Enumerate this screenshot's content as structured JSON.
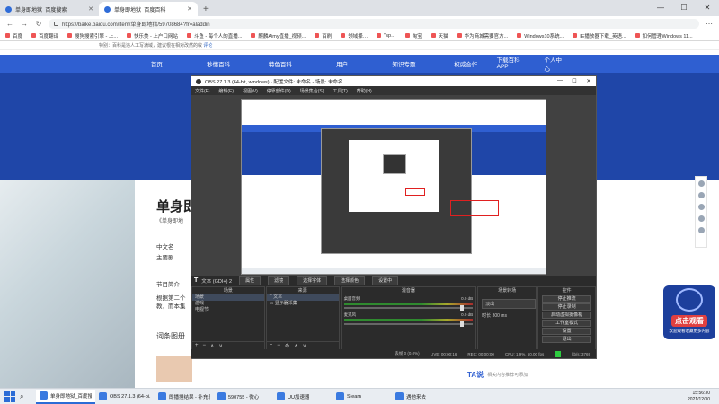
{
  "browser": {
    "tabs": [
      {
        "label": "单身即地狱_百度搜索",
        "active": false
      },
      {
        "label": "单身即地狱_百度百科",
        "active": true
      }
    ],
    "url": "https://baike.baidu.com/item/单身即地狱/59708684?fr=aladdin",
    "bookmarks": [
      "百度",
      "百度翻译",
      "搜狗搜索引擎 - 上...",
      "快乐美 - 上户口网站",
      "斗鱼 - 每个人的直播...",
      "麒麟Aimy直播_视频...",
      "百刷",
      "领域择…",
      "\"sp…",
      "淘宝",
      "天猫",
      "华为商城需要官方...",
      "Windows10系统...",
      "IE播放器下载_英语...",
      "如何管理Windows 11..."
    ]
  },
  "page": {
    "notice": "特别：百科是违人工写满域，建议根在相对改然的收",
    "notice_link": "评论",
    "nav": [
      "首页",
      "秒懂百科",
      "特色百科",
      "用户",
      "知识专题",
      "权威合作"
    ],
    "nav_right": [
      "下载百科APP",
      "个人中心"
    ],
    "title": "单身即",
    "subtitle": "《单身即地",
    "sections": [
      "中文名",
      "主要剧",
      "节目简介",
      "根据第二个",
      "教，而本集",
      "词条图册"
    ],
    "tashuo_logo": "TA说",
    "tashuo_text": "相关内容推荐可添加"
  },
  "watermark": {
    "title": "点击观看",
    "sub": "欢迎观看收藏更多内容"
  },
  "obs": {
    "title": "OBS 27.1.3 (64-bit, windows) - 配置文件: 未命名 - 场景: 未命名",
    "menus": [
      "文件(F)",
      "编辑(E)",
      "视图(V)",
      "停靠部件(D)",
      "场景集合(S)",
      "工具(T)",
      "帮助(H)"
    ],
    "source_label": "文本 (GDI+) 2",
    "source_buttons": [
      "属性",
      "滤镜",
      "选择字体",
      "选择颜色",
      "设置中"
    ],
    "docks": {
      "scenes_title": "场景",
      "scenes": [
        "场景",
        "游戏",
        "电视节"
      ],
      "sources_title": "来源",
      "sources": [
        "文本",
        "显示器采集"
      ],
      "mixer_title": "混音器",
      "mixer": [
        {
          "name": "桌面音频",
          "db": "0.0 dB"
        },
        {
          "name": "麦克风",
          "db": "0.0 dB"
        }
      ],
      "transitions_title": "场景转场",
      "transition": "淡出",
      "duration_label": "时长",
      "duration": "300 ms",
      "controls_title": "控件",
      "controls": [
        "停止推流",
        "停止录制",
        "启动虚拟摄像机",
        "工作室模式",
        "设置",
        "退出"
      ]
    },
    "status": [
      "丢帧 0 (0.0%)",
      "LIVE: 00:00:16",
      "REC: 00:00:00",
      "CPU: 1.9%, 60.00 fps",
      "kb/s: 3769"
    ]
  },
  "taskbar": {
    "items": [
      "单身即地狱_百度搜索",
      "OBS 27.1.3 (64-bi...",
      "即播搜结果 - 补充表",
      "590755 - 微心",
      "UU加速器",
      "Steam",
      "遇他来去"
    ],
    "time": "15:56:30",
    "date": "2021/12/30"
  }
}
